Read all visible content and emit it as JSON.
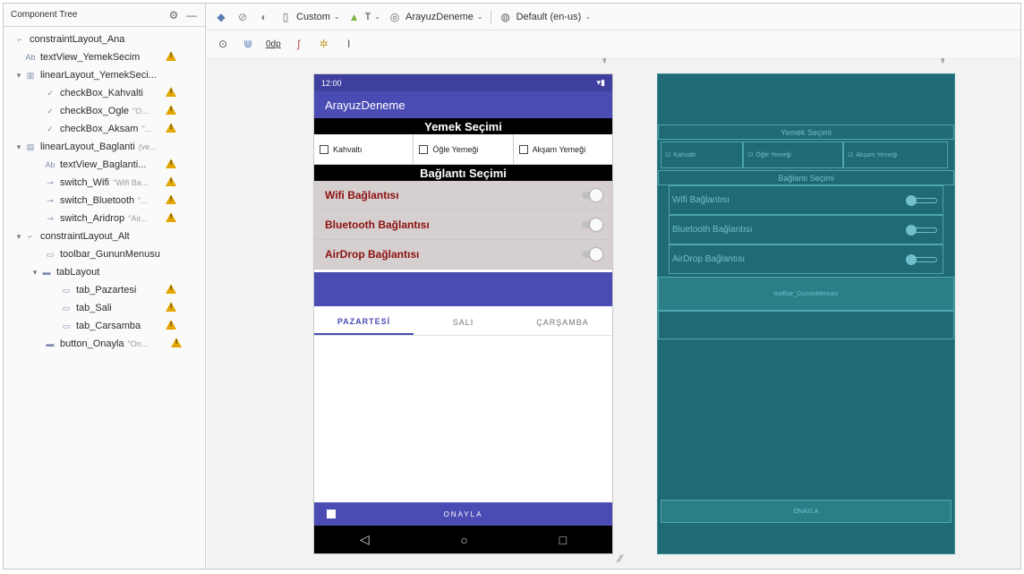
{
  "tree": {
    "title": "Component Tree",
    "items": [
      {
        "label": "constraintLayout_Ana",
        "hint": "",
        "warn": false
      },
      {
        "label": "textView_YemekSecim",
        "hint": "",
        "warn": true
      },
      {
        "label": "linearLayout_YemekSeci...",
        "hint": "",
        "warn": false
      },
      {
        "label": "checkBox_Kahvalti",
        "hint": "",
        "warn": true
      },
      {
        "label": "checkBox_Ogle",
        "hint": "\"O...",
        "warn": true
      },
      {
        "label": "checkBox_Aksam",
        "hint": "\"...",
        "warn": true
      },
      {
        "label": "linearLayout_Baglanti",
        "hint": "(ve...",
        "warn": false
      },
      {
        "label": "textView_Baglanti...",
        "hint": "",
        "warn": true
      },
      {
        "label": "switch_Wifi",
        "hint": "\"Wifi Ba...",
        "warn": true
      },
      {
        "label": "switch_Bluetooth",
        "hint": "\"...",
        "warn": true
      },
      {
        "label": "switch_Aridrop",
        "hint": "\"Air...",
        "warn": true
      },
      {
        "label": "constraintLayout_Alt",
        "hint": "",
        "warn": false
      },
      {
        "label": "toolbar_GununMenusu",
        "hint": "",
        "warn": false
      },
      {
        "label": "tabLayout",
        "hint": "",
        "warn": false
      },
      {
        "label": "tab_Pazartesi",
        "hint": "",
        "warn": true
      },
      {
        "label": "tab_Sali",
        "hint": "",
        "warn": true
      },
      {
        "label": "tab_Carsamba",
        "hint": "",
        "warn": true
      },
      {
        "label": "button_Onayla",
        "hint": "\"On...",
        "warn": true
      }
    ]
  },
  "toolbar": {
    "device": "Custom",
    "api": "T",
    "theme": "ArayuzDeneme",
    "locale": "Default (en-us)",
    "margin": "0dp"
  },
  "phone": {
    "time": "12:00",
    "app_title": "ArayuzDeneme",
    "yemek_title": "Yemek Seçimi",
    "checkboxes": [
      "Kahvaltı",
      "Öğle Yemeği",
      "Akşam Yemeği"
    ],
    "baglanti_title": "Bağlantı Seçimi",
    "switches": [
      "Wifi Bağlantısı",
      "Bluetooth Bağlantısı",
      "AirDrop Bağlantısı"
    ],
    "tabs": [
      "PAZARTESİ",
      "SALI",
      "ÇARŞAMBA"
    ],
    "button": "ONAYLA"
  },
  "blueprint": {
    "yemek_title": "Yemek Seçimi",
    "checkboxes": [
      "Kahvaltı",
      "Öğle Yemeği",
      "Akşam Yemeği"
    ],
    "baglanti_title": "Bağlantı Seçimi",
    "switches": [
      "Wifi Bağlantısı",
      "Bluetooth Bağlantısı",
      "AirDrop Bağlantısı"
    ],
    "toolbar_label": "toolbar_GununMenusu",
    "button": "ONAYLA"
  }
}
